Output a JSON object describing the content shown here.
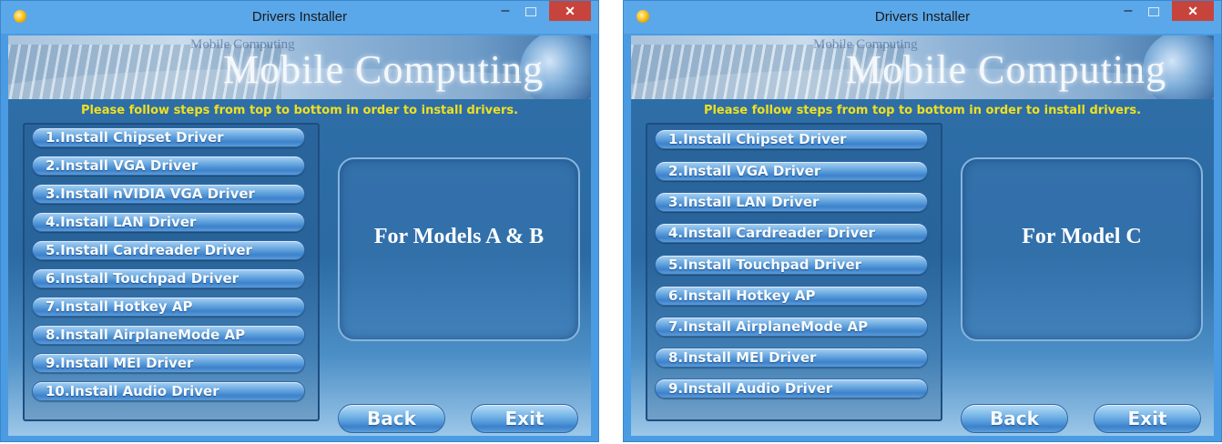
{
  "windows": [
    {
      "title": "Drivers Installer",
      "title_buttons": {
        "minimize": "–",
        "close": "✕"
      },
      "banner": {
        "brand_small": "Mobile Computing",
        "brand": "Mobile Computing"
      },
      "instruction": "Please follow steps from top to bottom in order to install drivers.",
      "driver_buttons": [
        "1.Install Chipset Driver",
        "2.Install VGA Driver",
        "3.Install nVIDIA VGA Driver",
        "4.Install LAN Driver",
        "5.Install Cardreader Driver",
        "6.Install Touchpad Driver",
        "7.Install Hotkey AP",
        "8.Install AirplaneMode AP",
        "9.Install MEI Driver",
        "10.Install Audio Driver"
      ],
      "info_text": "For Models A & B",
      "back_label": "Back",
      "exit_label": "Exit"
    },
    {
      "title": "Drivers Installer",
      "title_buttons": {
        "minimize": "–",
        "close": "✕"
      },
      "banner": {
        "brand_small": "Mobile Computing",
        "brand": "Mobile Computing"
      },
      "instruction": "Please follow steps from top to bottom in order to install drivers.",
      "driver_buttons": [
        "1.Install Chipset Driver",
        "2.Install VGA Driver",
        "3.Install LAN Driver",
        "4.Install Cardreader Driver",
        "5.Install Touchpad Driver",
        "6.Install Hotkey AP",
        "7.Install AirplaneMode AP",
        "8.Install MEI Driver",
        "9.Install Audio Driver"
      ],
      "info_text": "For Model C",
      "back_label": "Back",
      "exit_label": "Exit"
    }
  ]
}
